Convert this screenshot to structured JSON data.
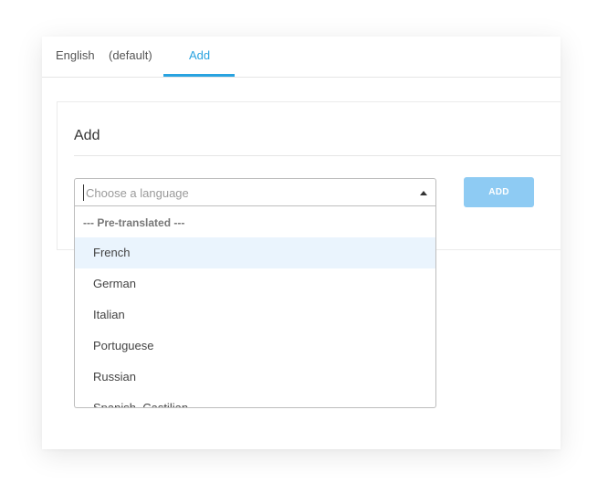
{
  "tabs": {
    "english_label": "English",
    "default_label": "(default)",
    "add_label": "Add",
    "active_color": "#29a3e0"
  },
  "panel": {
    "title": "Add"
  },
  "language_select": {
    "placeholder": "Choose a language",
    "value": "",
    "group_label": "--- Pre-translated ---",
    "options": [
      "French",
      "German",
      "Italian",
      "Portuguese",
      "Russian",
      "Spanish, Castilian"
    ],
    "highlighted_option": "French"
  },
  "add_button": {
    "label": "ADD",
    "color": "#8ecbf3"
  },
  "icons": {
    "select_caret": "caret-up-icon"
  }
}
